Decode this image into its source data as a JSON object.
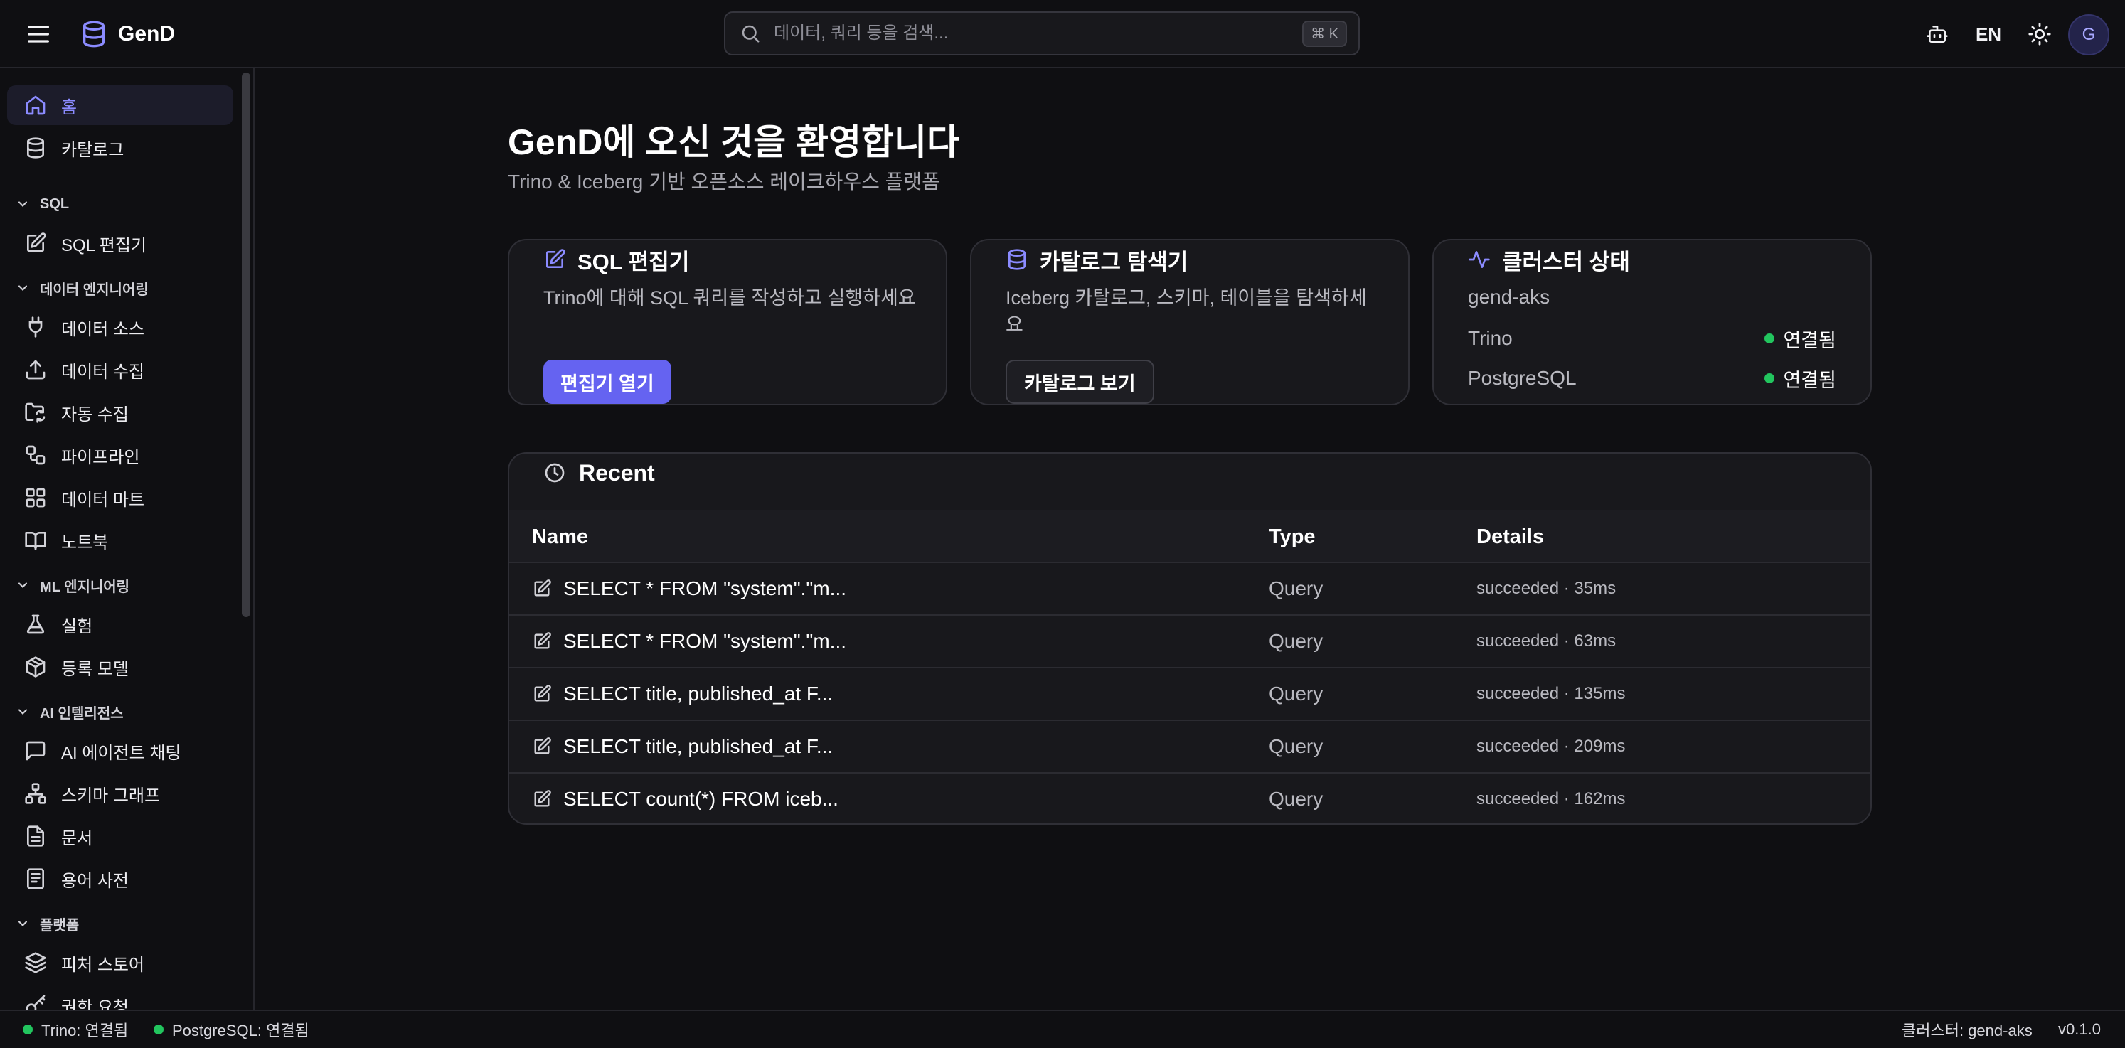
{
  "app": {
    "name": "GenD"
  },
  "topbar": {
    "search_placeholder": "데이터, 쿼리 등을 검색...",
    "search_shortcut": "⌘ K",
    "language": "EN",
    "avatar_initial": "G"
  },
  "sidebar": {
    "items": [
      {
        "label": "홈",
        "icon": "home-icon",
        "active": true
      },
      {
        "label": "카탈로그",
        "icon": "database-icon"
      },
      {
        "label": "SQL 편집기",
        "icon": "edit-icon"
      },
      {
        "label": "데이터 소스",
        "icon": "plug-icon"
      },
      {
        "label": "데이터 수집",
        "icon": "upload-icon"
      },
      {
        "label": "자동 수집",
        "icon": "folder-sync-icon"
      },
      {
        "label": "파이프라인",
        "icon": "workflow-icon"
      },
      {
        "label": "데이터 마트",
        "icon": "grid-icon"
      },
      {
        "label": "노트북",
        "icon": "book-icon"
      },
      {
        "label": "실험",
        "icon": "flask-icon"
      },
      {
        "label": "등록 모델",
        "icon": "package-icon"
      },
      {
        "label": "AI 에이전트 채팅",
        "icon": "chat-icon"
      },
      {
        "label": "스키마 그래프",
        "icon": "network-icon"
      },
      {
        "label": "문서",
        "icon": "document-icon"
      },
      {
        "label": "용어 사전",
        "icon": "glossary-icon"
      },
      {
        "label": "피처 스토어",
        "icon": "layers-icon"
      },
      {
        "label": "권한 요청",
        "icon": "key-icon"
      }
    ],
    "sections": [
      {
        "label": "SQL"
      },
      {
        "label": "데이터 엔지니어링"
      },
      {
        "label": "ML 엔지니어링"
      },
      {
        "label": "AI 인텔리전스"
      },
      {
        "label": "플랫폼"
      }
    ]
  },
  "main": {
    "title": "GenD에 오신 것을 환영합니다",
    "subtitle": "Trino & Iceberg 기반 오픈소스 레이크하우스 플랫폼",
    "cards": {
      "sql": {
        "title": "SQL 편집기",
        "description": "Trino에 대해 SQL 쿼리를 작성하고 실행하세요",
        "button": "편집기 열기"
      },
      "catalog": {
        "title": "카탈로그 탐색기",
        "description": "Iceberg 카탈로그, 스키마, 테이블을 탐색하세요",
        "button": "카탈로그 보기"
      },
      "cluster": {
        "title": "클러스터 상태",
        "name": "gend-aks",
        "services": [
          {
            "name": "Trino",
            "status": "연결됨"
          },
          {
            "name": "PostgreSQL",
            "status": "연결됨"
          }
        ]
      }
    },
    "recent": {
      "title": "Recent",
      "columns": {
        "name": "Name",
        "type": "Type",
        "details": "Details"
      },
      "rows": [
        {
          "name": "SELECT * FROM \"system\".\"m...",
          "type": "Query",
          "details": "succeeded · 35ms"
        },
        {
          "name": "SELECT * FROM \"system\".\"m...",
          "type": "Query",
          "details": "succeeded · 63ms"
        },
        {
          "name": "SELECT title, published_at F...",
          "type": "Query",
          "details": "succeeded · 135ms"
        },
        {
          "name": "SELECT title, published_at F...",
          "type": "Query",
          "details": "succeeded · 209ms"
        },
        {
          "name": "SELECT count(*) FROM iceb...",
          "type": "Query",
          "details": "succeeded · 162ms"
        }
      ]
    }
  },
  "statusbar": {
    "trino": "Trino: 연결됨",
    "postgres": "PostgreSQL: 연결됨",
    "cluster": "클러스터: gend-aks",
    "version": "v0.1.0"
  },
  "colors": {
    "accent": "#6563f1",
    "accent_text": "#8b8bff",
    "connected": "#22c55e",
    "background": "#0f0f12",
    "card": "#18181c"
  }
}
